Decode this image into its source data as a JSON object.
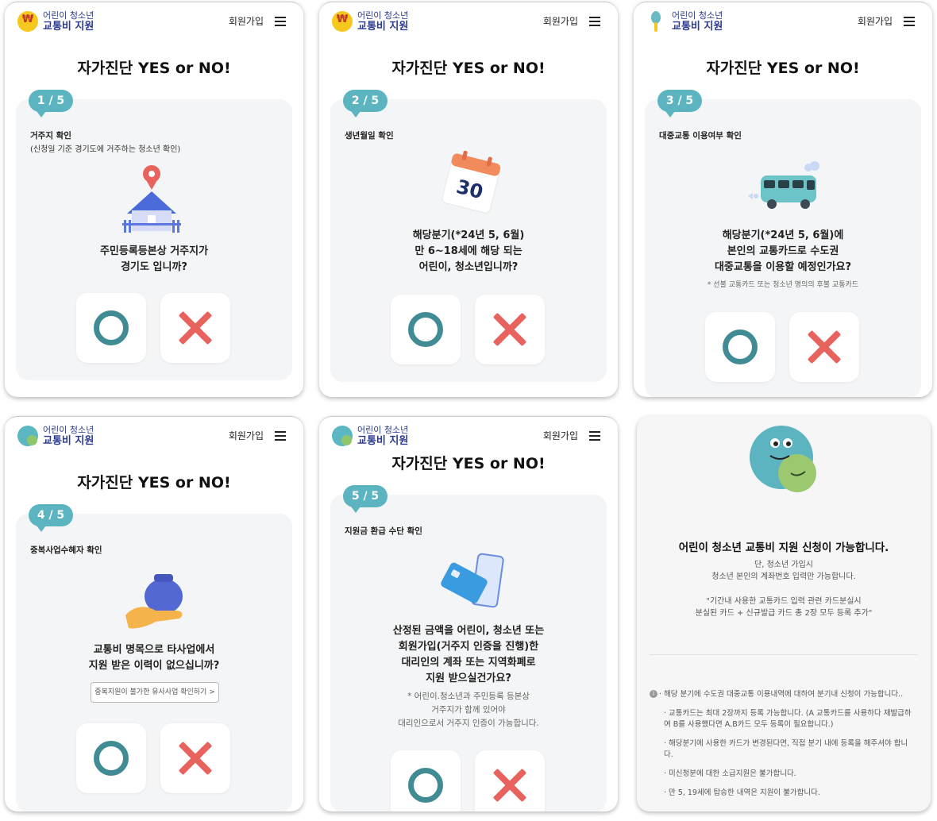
{
  "header": {
    "logo_line1": "어린이 청소년",
    "logo_line2": "교통비 지원",
    "logo_coin_symbol": "₩",
    "join_label": "회원가입"
  },
  "page_title": "자가진단 YES or NO!",
  "panels": [
    {
      "step": "1 / 5",
      "label": "거주지 확인",
      "sublabel": "(신청일 기준 경기도에 거주하는 청소년 확인)",
      "question_lines": [
        "주민등록등본상 거주지가",
        "경기도 입니까?"
      ],
      "illustration": "house-location-icon"
    },
    {
      "step": "2 / 5",
      "label": "생년월일 확인",
      "calendar_day": "30",
      "question_lines": [
        "해당분기(*24년 5, 6월)",
        "만 6~18세에 해당 되는",
        "어린이, 청소년입니까?"
      ],
      "illustration": "calendar-icon"
    },
    {
      "step": "3 / 5",
      "label": "대중교통 이용여부 확인",
      "question_lines": [
        "해당분기(*24년 5, 6월)에",
        "본인의 교통카드로 수도권",
        "대중교통을 이용할 예정인가요?"
      ],
      "note_lines": [
        "* 선불 교통카드 또는 청소년 명의의 후불 교통카드"
      ],
      "illustration": "bus-icon"
    },
    {
      "step": "4 / 5",
      "label": "중복사업수혜자 확인",
      "question_lines": [
        "교통비 명목으로 타사업에서",
        "지원 받은 이력이 없으십니까?"
      ],
      "link_label": "중복지원이 불가한 유사사업 확인하기 >",
      "illustration": "money-bag-hand-icon"
    },
    {
      "step": "5 / 5",
      "label": "지원금 환급 수단 확인",
      "question_lines": [
        "산정된 금액을 어린이, 청소년 또는",
        "회원가입(거주지 인증을 진행)한",
        "대리인의 계좌 또는 지역화폐로",
        "지원 받으실건가요?"
      ],
      "note_lines": [
        "* 어린이.청소년과 주민등록 등본상",
        "거주지가 함께 있어야",
        "대리인으로서 거주지 인증이 가능합니다."
      ],
      "illustration": "card-phone-icon"
    }
  ],
  "result": {
    "title": "어린이 청소년 교통비 지원 신청이 가능합니다.",
    "lines": [
      "단, 청소년 가입시",
      "청소년 본인의 계좌번호 입력만 가능합니다."
    ],
    "quote_lines": [
      "\"기간내 사용한 교통카드 입력 관련 카드분실시",
      "분실된 카드 + 신규발급 카드 총 2장 모두 등록 추가\""
    ],
    "info_items": [
      "· 해당 분기에 수도권 대중교통 이용내역에 대하여 분기내 신청이 가능합니다..",
      "· 교통카드는 최대 2장까지 등록 가능합니다. (A 교통카드를 사용하다 재발급하여 B를 사용했다면 A,B카드 모두 등록이 필요합니다.)",
      "· 해당분기에 사용한 카드가 변경된다면, 직접 분기 내에 등록을 해주셔야 합니다.",
      "· 미신청분에 대한 소급지원은 불가합니다.",
      "· 만 5, 19세에 탑승한 내역은 지원이 불가합니다."
    ]
  },
  "colors": {
    "step_badge": "#5bb4c0",
    "yes_ring": "#418b95",
    "no_cross": "#e8625e",
    "brand_text": "#2b3b8f",
    "card_bg": "#f4f5f6"
  }
}
